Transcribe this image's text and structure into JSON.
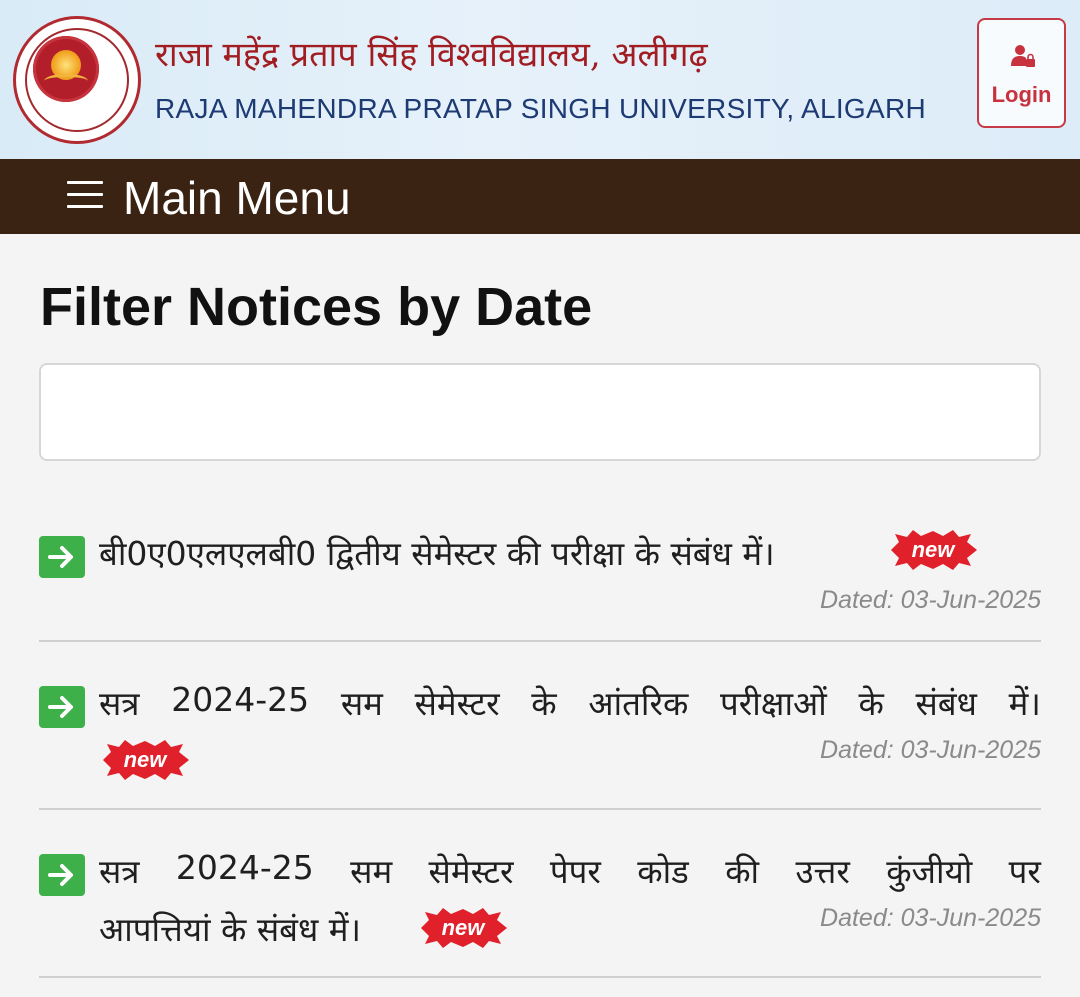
{
  "header": {
    "university_name_hindi": "राजा महेंद्र प्रताप सिंह विश्वविद्यालय, अलीगढ़",
    "university_name_english": "RAJA MAHENDRA PRATAP SINGH UNIVERSITY, ALIGARH",
    "logo_icon": "university-seal",
    "login_label": "Login",
    "login_icon": "user-lock-icon"
  },
  "nav": {
    "menu_icon": "hamburger-icon",
    "menu_label": "Main Menu"
  },
  "main": {
    "title": "Filter Notices by Date",
    "date_filter": {
      "value": "",
      "placeholder": ""
    },
    "notices": [
      {
        "title": "बी0ए0एलएलबी0 द्वितीय सेमेस्टर की परीक्षा के संबंध में।",
        "badge": "new",
        "date": "Dated: 03-Jun-2025"
      },
      {
        "title_words": [
          "सत्र",
          "2024-25",
          "सम",
          "सेमेस्टर",
          "के",
          "आंतरिक",
          "परीक्षाओं",
          "के",
          "संबंध",
          "में।"
        ],
        "badge": "new",
        "date": "Dated: 03-Jun-2025"
      },
      {
        "title_words": [
          "सत्र",
          "2024-25",
          "सम",
          "सेमेस्टर",
          "पेपर",
          "कोड",
          "की",
          "उत्तर",
          "कुंजीयो",
          "पर"
        ],
        "title_line2": "आपत्तियां के संबंध में।",
        "badge": "new",
        "date": "Dated: 03-Jun-2025"
      }
    ]
  },
  "colors": {
    "brand_red": "#a11d22",
    "brand_blue": "#1d3a73",
    "nav_brown": "#3a2313",
    "arrow_green": "#3db04a",
    "badge_red": "#e0202a"
  }
}
